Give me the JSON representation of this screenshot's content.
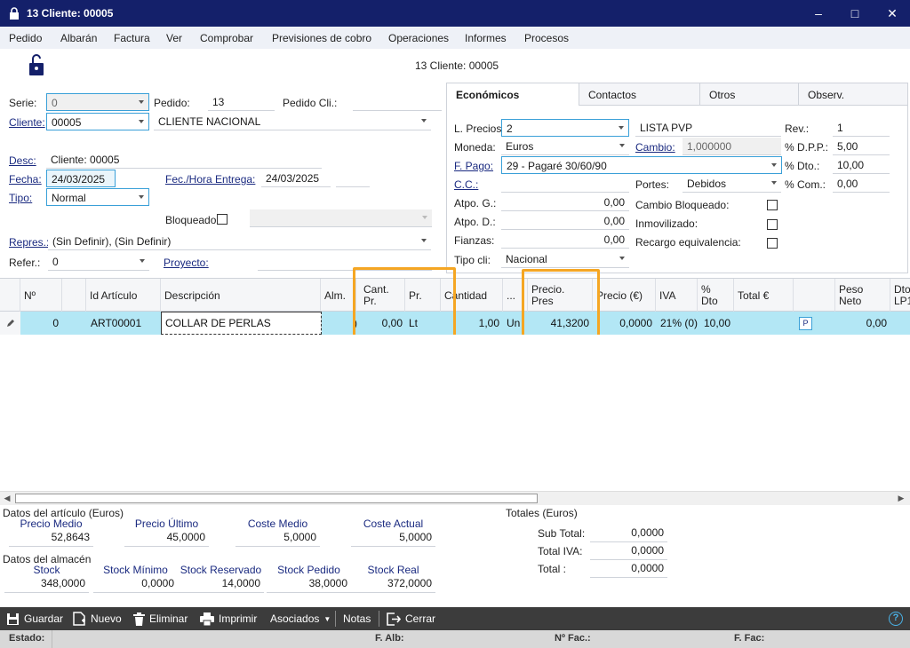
{
  "window": {
    "title": "13 Cliente: 00005"
  },
  "menu": [
    "Pedido",
    "Albarán",
    "Factura",
    "Ver",
    "Comprobar",
    "Previsiones de cobro",
    "Operaciones",
    "Informes",
    "Procesos"
  ],
  "header": {
    "record_title": "13 Cliente: 00005"
  },
  "form": {
    "serie_label": "Serie:",
    "serie_value": "0",
    "pedido_label": "Pedido:",
    "pedido_value": "13",
    "pedido_cli_label": "Pedido Cli.:",
    "pedido_cli_value": "",
    "cliente_label": "Cliente:",
    "cliente_code": "00005",
    "cliente_name": "CLIENTE NACIONAL",
    "desc_label": "Desc:",
    "desc_value": "Cliente: 00005",
    "fecha_label": "Fecha:",
    "fecha_value": "24/03/2025",
    "fec_entrega_label": "Fec./Hora Entrega:",
    "fec_entrega_value": "24/03/2025",
    "hora_value": "",
    "tipo_label": "Tipo:",
    "tipo_value": "Normal",
    "bloqueado_label": "Bloqueado",
    "repres_label": "Repres.:",
    "repres_value": "(Sin Definir), (Sin Definir)",
    "refer_label": "Refer.:",
    "refer_value": "0",
    "proyecto_label": "Proyecto:",
    "proyecto_value": ""
  },
  "tabs": [
    "Económicos",
    "Contactos",
    "Otros",
    "Observ."
  ],
  "economicos": {
    "lprecios_label": "L. Precios",
    "lprecios_value": "2",
    "lprecios_name": "LISTA PVP",
    "rev_label": "Rev.:",
    "rev_value": "1",
    "moneda_label": "Moneda:",
    "moneda_value": "Euros",
    "cambio_label": "Cambio:",
    "cambio_value": "1,000000",
    "dpp_label": "% D.P.P.:",
    "dpp_value": "5,00",
    "fpago_label": "F. Pago:",
    "fpago_value": "29 - Pagaré 30/60/90",
    "dto_label": "% Dto.:",
    "dto_value": "10,00",
    "cc_label": "C.C.:",
    "cc_value": "",
    "portes_label": "Portes:",
    "portes_value": "Debidos",
    "com_label": "% Com.:",
    "com_value": "0,00",
    "atpog_label": "Atpo. G.:",
    "atpog_value": "0,00",
    "atpod_label": "Atpo. D.:",
    "atpod_value": "0,00",
    "fianzas_label": "Fianzas:",
    "fianzas_value": "0,00",
    "tipocli_label": "Tipo cli:",
    "tipocli_value": "Nacional",
    "cambio_bloq_label": "Cambio Bloqueado:",
    "inmovilizado_label": "Inmovilizado:",
    "recargo_label": "Recargo equivalencia:"
  },
  "grid": {
    "headers": {
      "n": "Nº",
      "id": "Id Artículo",
      "desc": "Descripción",
      "alm": "Alm.",
      "cant_pr": "Cant.\nPr.",
      "pr": "Pr.",
      "cantidad": "Cantidad",
      "dots": "...",
      "precio_pres": "Precio.\nPres",
      "precio": "Precio (€)",
      "iva": "IVA",
      "pdto": "%\nDto",
      "total": "Total €",
      "peso": "Peso\nNeto",
      "dto_lp": "Dto\nLP1"
    },
    "row": {
      "n": "0",
      "id": "ART00001",
      "desc": "COLLAR DE PERLAS",
      "alm": ")",
      "cant_pr": "0,00",
      "pr": "Lt",
      "cantidad": "1,00",
      "ud": "Un",
      "precio_pres": "41,3200",
      "precio": "0,0000",
      "iva": "21% (0)",
      "pdto": "10,00",
      "total": "",
      "p_badge": "P",
      "peso": "0,00"
    }
  },
  "articulo": {
    "title": "Datos del artículo (Euros)",
    "labels": [
      "Precio Medio",
      "Precio Último",
      "Coste Medio",
      "Coste Actual"
    ],
    "values": [
      "52,8643",
      "45,0000",
      "5,0000",
      "5,0000"
    ]
  },
  "almacen": {
    "title": "Datos del almacén",
    "labels": [
      "Stock",
      "Stock Mínimo",
      "Stock Reservado",
      "Stock Pedido",
      "Stock Real"
    ],
    "values": [
      "348,0000",
      "0,0000",
      "14,0000",
      "38,0000",
      "372,0000"
    ]
  },
  "totales": {
    "title": "Totales (Euros)",
    "subtotal_label": "Sub Total:",
    "subtotal_value": "0,0000",
    "iva_label": "Total IVA:",
    "iva_value": "0,0000",
    "total_label": "Total :",
    "total_value": "0,0000"
  },
  "toolbar": {
    "guardar": "Guardar",
    "nuevo": "Nuevo",
    "eliminar": "Eliminar",
    "imprimir": "Imprimir",
    "asociados": "Asociados",
    "notas": "Notas",
    "cerrar": "Cerrar"
  },
  "status": {
    "estado": "Estado:",
    "falb": "F. Alb:",
    "nfac": "Nº Fac.:",
    "ffac": "F. Fac:"
  }
}
